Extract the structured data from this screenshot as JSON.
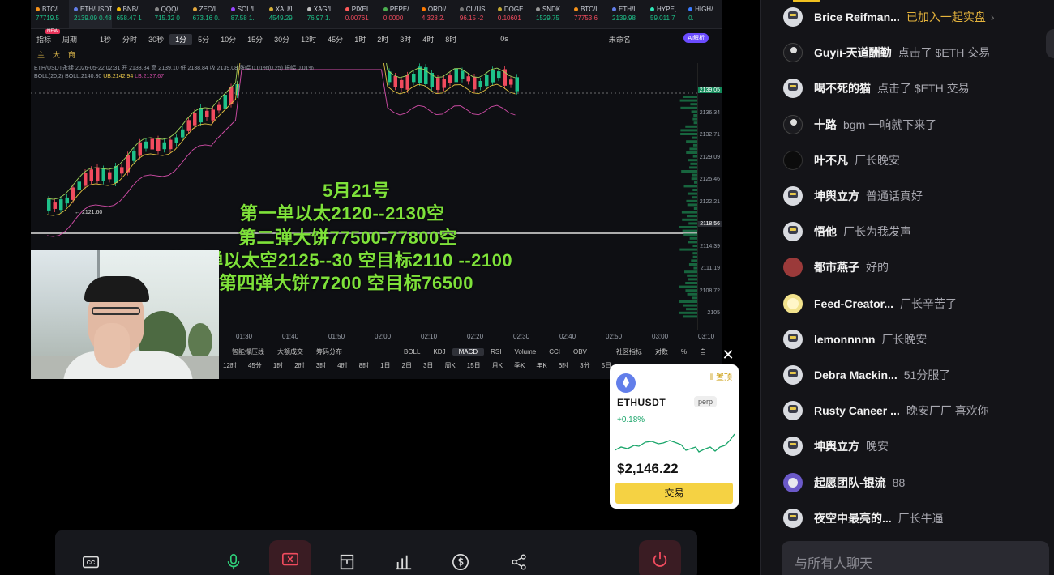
{
  "ticker_bar": [
    {
      "symbol": "BTC/L",
      "price": "77719.5",
      "color": "#f7931a",
      "down": false
    },
    {
      "symbol": "ETH/USDT永续",
      "price": "2139.09 0.48%",
      "color": "#627eea",
      "down": false,
      "active": true
    },
    {
      "symbol": "BNB/I",
      "price": "658.47 1",
      "color": "#f0b90b",
      "down": false
    },
    {
      "symbol": "QQQ/",
      "price": "715.32 0",
      "color": "#888888",
      "down": false
    },
    {
      "symbol": "ZEC/L",
      "price": "673.16 0.",
      "color": "#e5a93d",
      "down": false
    },
    {
      "symbol": "SOL/L",
      "price": "87.58 1.",
      "color": "#9945ff",
      "down": false
    },
    {
      "symbol": "XAU/I",
      "price": "4549.29",
      "color": "#d4af37",
      "down": false
    },
    {
      "symbol": "XAG/I",
      "price": "76.97 1.",
      "color": "#c0c0c0",
      "down": false
    },
    {
      "symbol": "PIXEL",
      "price": "0.00761",
      "color": "#ff5a5a",
      "down": true
    },
    {
      "symbol": "PEPE/",
      "price": "0.0000",
      "color": "#4caf50",
      "down": true
    },
    {
      "symbol": "ORDI/",
      "price": "4.328 2.",
      "color": "#ff7a00",
      "down": true
    },
    {
      "symbol": "CL/US",
      "price": "96.15 -2",
      "color": "#777777",
      "down": true
    },
    {
      "symbol": "DOGE",
      "price": "0.10601",
      "color": "#c2a633",
      "down": true
    },
    {
      "symbol": "SNDK",
      "price": "1529.75",
      "color": "#999999",
      "down": false
    },
    {
      "symbol": "BTC/L",
      "price": "77753.6",
      "color": "#f7931a",
      "down": true
    },
    {
      "symbol": "ETH/L",
      "price": "2139.98",
      "color": "#627eea",
      "down": false
    },
    {
      "symbol": "HYPE,",
      "price": "59.011 7",
      "color": "#2ee6b6",
      "down": false
    },
    {
      "symbol": "HIGH/",
      "price": "0.",
      "color": "#3a7bff",
      "down": false
    }
  ],
  "timeframe_bar": {
    "items": [
      "指标",
      "周期",
      "1秒",
      "分时",
      "30秒",
      "1分",
      "5分",
      "10分",
      "15分",
      "30分",
      "12时",
      "45分",
      "1时",
      "2时",
      "3时",
      "4时",
      "8时"
    ],
    "selected": "1分",
    "new_badge": "NEW",
    "zero_s": "0s",
    "unnamed": "未命名",
    "ai_button": "AI解析"
  },
  "tool_bar": [
    "主",
    "大",
    "商"
  ],
  "chart_meta": {
    "line1": "ETH/USDT永续  2026-05-22 02:31  开 2138.84  高 2139.10  低 2138.84  收 2139.08  涨幅 0.01%(0.25)  振幅 0.01%",
    "line2_prefix": "BOLL(20,2)  BOLL:2140.30",
    "ub": "UB:2142.94",
    "lb": "LB:2137.67"
  },
  "price_axis": [
    "2139.05",
    "2136.34",
    "2132.71",
    "2129.09",
    "2125.46",
    "2122.21",
    "2118.56",
    "2114.39",
    "2111.19",
    "2108.72",
    "2105"
  ],
  "price_marker_low": "← 2121.60",
  "time_axis": [
    "01:30",
    "01:40",
    "01:50",
    "02:00",
    "02:10",
    "02:20",
    "02:30",
    "02:40",
    "02:50",
    "03:00",
    "03:10"
  ],
  "indicator_bar": {
    "left_items": [
      "智能撑压线",
      "大额成交",
      "筹码分布"
    ],
    "items": [
      "BOLL",
      "KDJ",
      "MACD",
      "RSI",
      "Volume",
      "CCI",
      "OBV"
    ],
    "selected": "MACD",
    "right_items": [
      "社区指标",
      "对数",
      "%",
      "自"
    ]
  },
  "timeframe_bar2": [
    "12时",
    "45分",
    "1时",
    "2时",
    "3时",
    "4时",
    "8时",
    "1日",
    "2日",
    "3日",
    "周K",
    "15日",
    "月K",
    "季K",
    "年K",
    "6时",
    "3分",
    "5日"
  ],
  "overlay": {
    "line1": "5月21号",
    "line2": "第一单以太2120--2130空",
    "line3": "第二弹大饼77500-77800空",
    "line4": "第三弹以太空2125--30 空目标2110 --2100",
    "line5": "第四弹大饼77200 空目标76500"
  },
  "coin_card": {
    "symbol": "ETHUSDT",
    "type": "perp",
    "change": "+0.18%",
    "price": "$2,146.22",
    "trade_label": "交易",
    "pin_label": "置顶",
    "close_label": "✕",
    "up_color": "#1aa56a",
    "accent": "#f5d243"
  },
  "controls": [
    "cc-icon",
    "mic-icon",
    "screen-share-off-icon",
    "gift-box-icon",
    "bar-chart-icon",
    "dollar-icon",
    "share-icon",
    "power-icon"
  ],
  "controls_cc": "CC",
  "chat": {
    "messages": [
      {
        "user": "Brice Reifman...",
        "msg": "已加入一起实盘",
        "avatar": "robot",
        "gold": true,
        "chevron": "›"
      },
      {
        "user": "Guyii-天道酬勤",
        "msg": "点击了 $ETH 交易",
        "avatar": "dark"
      },
      {
        "user": "喝不死的猫",
        "msg": "点击了 $ETH 交易",
        "avatar": "robot"
      },
      {
        "user": "十路",
        "msg": "bgm 一响就下来了",
        "avatar": "dark"
      },
      {
        "user": "叶不凡",
        "msg": "厂长晚安",
        "avatar": "black"
      },
      {
        "user": "坤舆立方",
        "msg": "普通话真好",
        "avatar": "robot"
      },
      {
        "user": "悟他",
        "msg": "厂长为我发声",
        "avatar": "robot"
      },
      {
        "user": "都市燕子",
        "msg": "好的",
        "avatar": "red"
      },
      {
        "user": "Feed-Creator...",
        "msg": "厂长辛苦了",
        "avatar": "yellow"
      },
      {
        "user": "lemonnnnn",
        "msg": "厂长晚安",
        "avatar": "robot"
      },
      {
        "user": "Debra Mackin...",
        "msg": "51分服了",
        "avatar": "robot"
      },
      {
        "user": "Rusty Caneer ...",
        "msg": "晚安厂厂 喜欢你",
        "avatar": "robot"
      },
      {
        "user": "坤舆立方",
        "msg": "晚安",
        "avatar": "robot"
      },
      {
        "user": "起愿团队-银流",
        "msg": "88",
        "avatar": "purple"
      },
      {
        "user": "夜空中最亮的...",
        "msg": "厂长牛逼",
        "avatar": "robot"
      }
    ],
    "input_placeholder": "与所有人聊天"
  }
}
